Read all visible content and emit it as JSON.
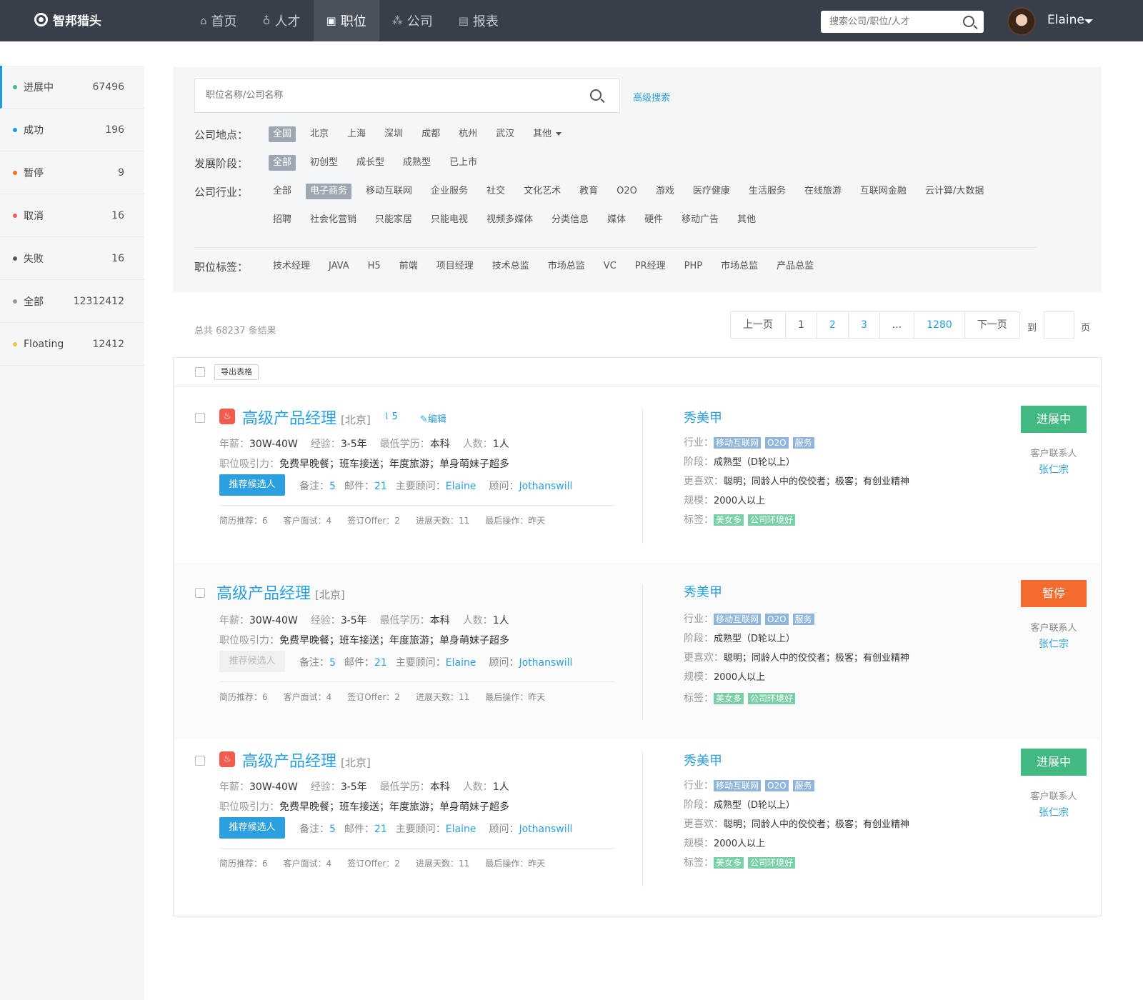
{
  "topbar": {
    "logo": "智邦猎头",
    "nav": [
      {
        "label": "首页",
        "icon": "home-icon"
      },
      {
        "label": "人才",
        "icon": "talent-icon"
      },
      {
        "label": "职位",
        "icon": "briefcase-icon",
        "active": true
      },
      {
        "label": "公司",
        "icon": "company-icon"
      },
      {
        "label": "报表",
        "icon": "report-icon"
      }
    ],
    "search_placeholder": "搜索公司/职位/人才",
    "user_name": "Elaine"
  },
  "sidebar": {
    "items": [
      {
        "label": "进展中",
        "count": "67496",
        "color": "#42b983",
        "active": true
      },
      {
        "label": "成功",
        "count": "196",
        "color": "#1d9be0"
      },
      {
        "label": "暂停",
        "count": "9",
        "color": "#f56a2f"
      },
      {
        "label": "取消",
        "count": "16",
        "color": "#f25c5c"
      },
      {
        "label": "失败",
        "count": "16",
        "color": "#555555"
      },
      {
        "label": "全部",
        "count": "12312412",
        "color": "#999999"
      },
      {
        "label": "Floating",
        "count": "12412",
        "color": "#f5c542"
      }
    ]
  },
  "filter": {
    "search_placeholder": "职位名称/公司名称",
    "advanced": "高级搜索",
    "location": {
      "label": "公司地点：",
      "options": [
        "全国",
        "北京",
        "上海",
        "深圳",
        "成都",
        "杭州",
        "武汉"
      ],
      "more": "其他"
    },
    "stage": {
      "label": "发展阶段：",
      "options": [
        "全部",
        "初创型",
        "成长型",
        "成熟型",
        "已上市"
      ]
    },
    "industry": {
      "label": "公司行业：",
      "row1": [
        "全部",
        "电子商务",
        "移动互联网",
        "企业服务",
        "社交",
        "文化艺术",
        "教育",
        "O2O",
        "游戏",
        "医疗健康",
        "生活服务",
        "在线旅游",
        "互联网金融",
        "云计算/大数据"
      ],
      "row2": [
        "招聘",
        "社会化营销",
        "只能家居",
        "只能电视",
        "视频多媒体",
        "分类信息",
        "媒体",
        "硬件",
        "移动广告",
        "其他"
      ]
    },
    "tags": {
      "label": "职位标签：",
      "options": [
        "技术经理",
        "JAVA",
        "H5",
        "前端",
        "项目经理",
        "技术总监",
        "市场总监",
        "VC",
        "PR经理",
        "PHP",
        "市场总监",
        "产品总监"
      ]
    }
  },
  "results": {
    "total": "总共 68237 条结果",
    "pager": {
      "prev": "上一页",
      "pages": [
        "1",
        "2",
        "3",
        "...",
        "1280"
      ],
      "next": "下一页",
      "goto": "到",
      "page_unit": "页"
    },
    "export": "导出表格"
  },
  "jobs": [
    {
      "hot": true,
      "title": "高级产品经理",
      "city": "[北京]",
      "attachments": "5",
      "edit": "编辑",
      "salary_k": "年薪：",
      "salary": "30W-40W",
      "exp_k": "经验：",
      "exp": "3-5年",
      "edu_k": "最低学历：",
      "edu": "本科",
      "num_k": "人数：",
      "num": "1人",
      "attract_k": "职位吸引力：",
      "attract": "免费早晚餐；班车接送；年度旅游；单身萌妹子超多",
      "recommend": "推荐候选人",
      "recommend_disabled": false,
      "notes_k": "备注：",
      "notes": "5",
      "mail_k": "邮件：",
      "mail": "21",
      "main_k": "主要顾问：",
      "main": "Elaine",
      "adv_k": "顾问：",
      "adv": "Jothanswill",
      "stats": [
        "简历推荐：6",
        "客户面试：4",
        "签订Offer：2",
        "进展天数：11",
        "最后操作：昨天"
      ],
      "company": "秀美甲",
      "industry_k": "行业：",
      "industry_tags": [
        "移动互联网",
        "O2O",
        "服务"
      ],
      "stage_k": "阶段：",
      "stage": "成熟型（D轮以上）",
      "likes_k": "更喜欢：",
      "likes": "聪明；同龄人中的佼佼者；极客；有创业精神",
      "size_k": "规模：",
      "size": "2000人以上",
      "tags_k": "标签：",
      "tags": [
        "美女多",
        "公司环境好"
      ],
      "status": "进展中",
      "status_color": "#42b983",
      "contact_k": "客户联系人",
      "contact": "张仁宗"
    },
    {
      "hot": false,
      "title": "高级产品经理",
      "city": "[北京]",
      "salary_k": "年薪：",
      "salary": "30W-40W",
      "exp_k": "经验：",
      "exp": "3-5年",
      "edu_k": "最低学历：",
      "edu": "本科",
      "num_k": "人数：",
      "num": "1人",
      "attract_k": "职位吸引力：",
      "attract": "免费早晚餐；班车接送；年度旅游；单身萌妹子超多",
      "recommend": "推荐候选人",
      "recommend_disabled": true,
      "notes_k": "备注：",
      "notes": "5",
      "mail_k": "邮件：",
      "mail": "21",
      "main_k": "主要顾问：",
      "main": "Elaine",
      "adv_k": "顾问：",
      "adv": "Jothanswill",
      "stats": [
        "简历推荐：6",
        "客户面试：4",
        "签订Offer：2",
        "进展天数：11",
        "最后操作：昨天"
      ],
      "company": "秀美甲",
      "industry_k": "行业：",
      "industry_tags": [
        "移动互联网",
        "O2O",
        "服务"
      ],
      "stage_k": "阶段：",
      "stage": "成熟型（D轮以上）",
      "likes_k": "更喜欢：",
      "likes": "聪明；同龄人中的佼佼者；极客；有创业精神",
      "size_k": "规模：",
      "size": "2000人以上",
      "tags_k": "标签：",
      "tags": [
        "美女多",
        "公司环境好"
      ],
      "status": "暂停",
      "status_color": "#f56a2f",
      "contact_k": "客户联系人",
      "contact": "张仁宗"
    },
    {
      "hot": true,
      "title": "高级产品经理",
      "city": "[北京]",
      "salary_k": "年薪：",
      "salary": "30W-40W",
      "exp_k": "经验：",
      "exp": "3-5年",
      "edu_k": "最低学历：",
      "edu": "本科",
      "num_k": "人数：",
      "num": "1人",
      "attract_k": "职位吸引力：",
      "attract": "免费早晚餐；班车接送；年度旅游；单身萌妹子超多",
      "recommend": "推荐候选人",
      "recommend_disabled": false,
      "notes_k": "备注：",
      "notes": "5",
      "mail_k": "邮件：",
      "mail": "21",
      "main_k": "主要顾问：",
      "main": "Elaine",
      "adv_k": "顾问：",
      "adv": "Jothanswill",
      "stats": [
        "简历推荐：6",
        "客户面试：4",
        "签订Offer：2",
        "进展天数：11",
        "最后操作：昨天"
      ],
      "company": "秀美甲",
      "industry_k": "行业：",
      "industry_tags": [
        "移动互联网",
        "O2O",
        "服务"
      ],
      "stage_k": "阶段：",
      "stage": "成熟型（D轮以上）",
      "likes_k": "更喜欢：",
      "likes": "聪明；同龄人中的佼佼者；极客；有创业精神",
      "size_k": "规模：",
      "size": "2000人以上",
      "tags_k": "标签：",
      "tags": [
        "美女多",
        "公司环境好"
      ],
      "status": "进展中",
      "status_color": "#42b983",
      "contact_k": "客户联系人",
      "contact": "张仁宗"
    }
  ]
}
